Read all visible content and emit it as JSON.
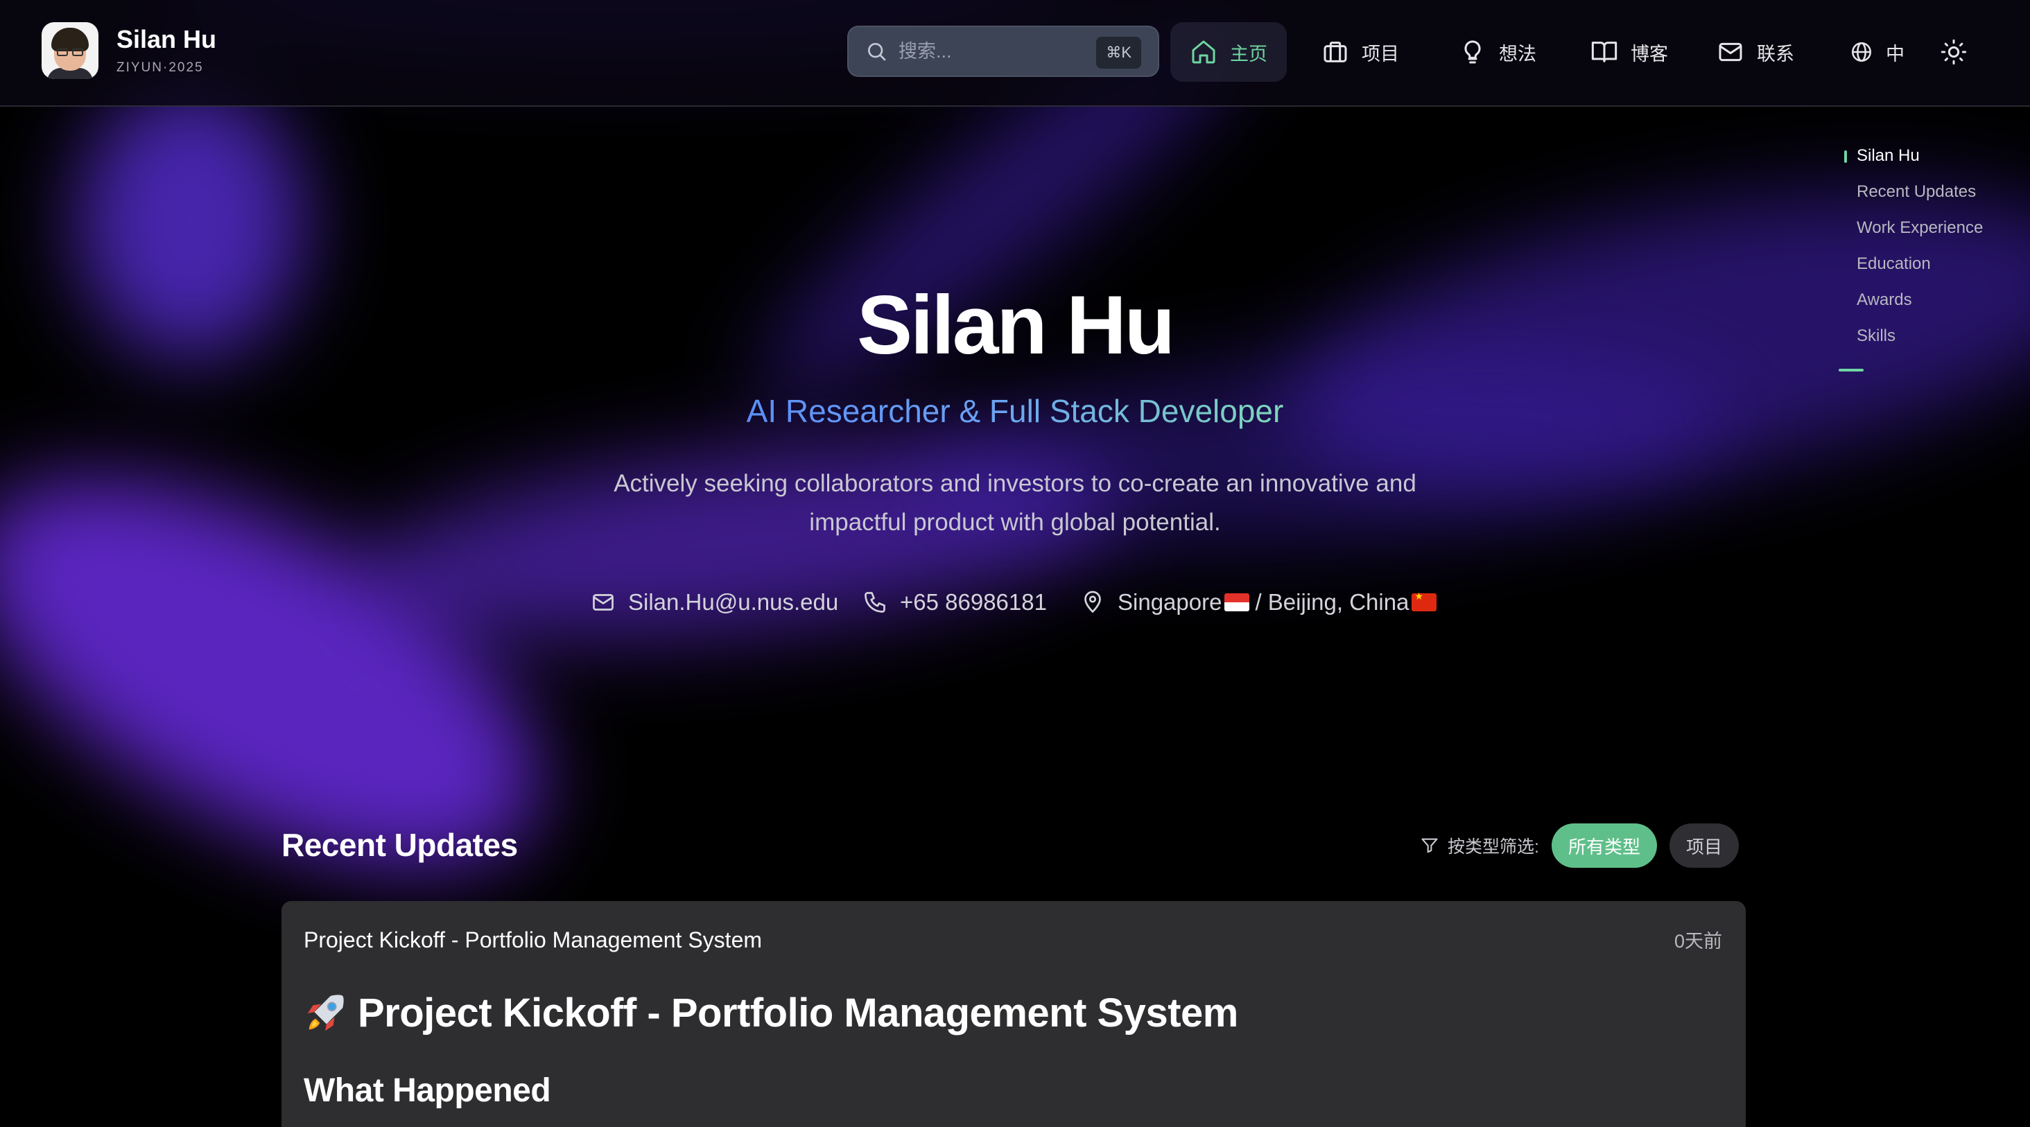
{
  "brand": {
    "name": "Silan Hu",
    "subtitle": "ZIYUN·2025"
  },
  "search": {
    "placeholder": "搜索...",
    "shortcut": "⌘K"
  },
  "nav": {
    "items": [
      {
        "label": "主页",
        "icon": "home-icon",
        "active": true
      },
      {
        "label": "项目",
        "icon": "briefcase-icon",
        "active": false
      },
      {
        "label": "想法",
        "icon": "lightbulb-icon",
        "active": false
      },
      {
        "label": "博客",
        "icon": "book-icon",
        "active": false
      },
      {
        "label": "联系",
        "icon": "mail-icon",
        "active": false
      }
    ],
    "language": "中",
    "theme_icon": "sun-icon"
  },
  "toc": {
    "items": [
      "Silan Hu",
      "Recent Updates",
      "Work Experience",
      "Education",
      "Awards",
      "Skills"
    ],
    "active": "Silan Hu"
  },
  "hero": {
    "name": "Silan Hu",
    "title": "AI Researcher & Full Stack Developer",
    "desc_line1": "Actively seeking collaborators and investors to co-create an innovative and",
    "desc_line2": "impactful product with global potential.",
    "email": "Silan.Hu@u.nus.edu",
    "phone": "+65 86986181",
    "location_a": "Singapore",
    "location_b": " / Beijing, China"
  },
  "updates": {
    "heading": "Recent Updates",
    "filter_label": "按类型筛选:",
    "filters": [
      "所有类型",
      "项目"
    ],
    "card": {
      "title": "Project Kickoff - Portfolio Management System",
      "time": "0天前",
      "h1": "Project Kickoff - Portfolio Management System",
      "h2": "What Happened"
    }
  },
  "colors": {
    "accent": "#6fd6a2",
    "chip_active": "#5fbf8a",
    "gradient_start": "#5c8ff7",
    "gradient_end": "#7fd9b8"
  }
}
